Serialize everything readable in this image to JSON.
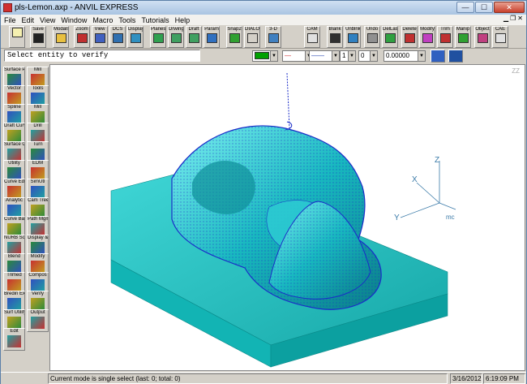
{
  "window": {
    "title": "pls-Lemon.axp - ANVIL EXPRESS"
  },
  "menu": [
    "File",
    "Edit",
    "View",
    "Window",
    "Macro",
    "Tools",
    "Tutorials",
    "Help"
  ],
  "toolbar": [
    {
      "label": "",
      "icon": "new-file-icon",
      "color": "#f5f0b0"
    },
    {
      "label": "Save",
      "icon": "save-icon",
      "color": "#222222"
    },
    {
      "label": "Modals",
      "icon": "modals-basic-icon",
      "color": "#e8c040"
    },
    {
      "label": "Zoom",
      "icon": "zoom-icon",
      "color": "#c03030"
    },
    {
      "label": "View",
      "icon": "view-icon",
      "color": "#4060c0"
    },
    {
      "label": "DCS",
      "icon": "dcs-icon",
      "color": "#3070b0"
    },
    {
      "label": "Display",
      "icon": "display-icon",
      "color": "#3090c0"
    },
    {
      "label": "Planes",
      "icon": "planes-icon",
      "color": "#30a050"
    },
    {
      "label": "Drwing",
      "icon": "drawing-icon",
      "color": "#40a060"
    },
    {
      "label": "Draft",
      "icon": "draft-icon",
      "color": "#40a060"
    },
    {
      "label": "Param",
      "icon": "param-icon",
      "color": "#3070c0"
    },
    {
      "label": "Snap2",
      "icon": "snap-icon",
      "color": "#30a030"
    },
    {
      "label": "DIALOG",
      "icon": "dialog-icon",
      "color": "#d4d0c8"
    },
    {
      "label": "3-D",
      "icon": "3d-icon",
      "color": "#4080c0"
    },
    {
      "label": "CAM",
      "icon": "cam-icon",
      "color": "#e0e0e0"
    },
    {
      "label": "Blank",
      "icon": "blank-icon",
      "color": "#303030"
    },
    {
      "label": "Unblnk",
      "icon": "unblank-icon",
      "color": "#3080c0"
    },
    {
      "label": "Undo",
      "icon": "undo-icon",
      "color": "#909090"
    },
    {
      "label": "DelLast",
      "icon": "delete-last-icon",
      "color": "#30a040"
    },
    {
      "label": "Delete",
      "icon": "delete-icon",
      "color": "#c03030"
    },
    {
      "label": "Modify",
      "icon": "modify-icon",
      "color": "#c040c0"
    },
    {
      "label": "Trim",
      "icon": "trim-icon",
      "color": "#c03030"
    },
    {
      "label": "Manip",
      "icon": "manip-icon",
      "color": "#30a030"
    },
    {
      "label": "Object",
      "icon": "object-icon",
      "color": "#c04080"
    },
    {
      "label": "CAE",
      "icon": "cae-icon",
      "color": "#e0e0e0"
    }
  ],
  "prompt": "Select entity to verify",
  "attributes": {
    "color": "#00a000",
    "line_style": "—",
    "line_weight": "——",
    "layer": "1",
    "pen": "0",
    "value": "0.00000"
  },
  "leftTools": [
    [
      "Surface Point",
      "Mill"
    ],
    [
      "Vector",
      "Tools"
    ],
    [
      "Spline",
      "Mill"
    ],
    [
      "Draft Curve",
      "Drill"
    ],
    [
      "Surface Curve",
      "Turn"
    ],
    [
      "Utility",
      "EDM"
    ],
    [
      "Curve Editor",
      "SimUtl"
    ],
    [
      "Analytic",
      "Cam Tree"
    ],
    [
      "Curve Bases",
      "Path Mgmt"
    ],
    [
      "NURB Solid",
      "Display & Edit"
    ],
    [
      "Blend",
      "Modify"
    ],
    [
      "Trimed",
      "Compos"
    ],
    [
      "Bredin Exist",
      "Verify"
    ],
    [
      "Surf Utility",
      "Output"
    ],
    [
      "Edit",
      ""
    ]
  ],
  "axes": {
    "x": "X",
    "y": "Y",
    "z": "Z",
    "label": "mc"
  },
  "corner_label": "ZZ",
  "status": {
    "mode": "Current mode is single select (last: 0; total: 0)",
    "date": "3/16/2012",
    "time": "6:19:09 PM"
  }
}
